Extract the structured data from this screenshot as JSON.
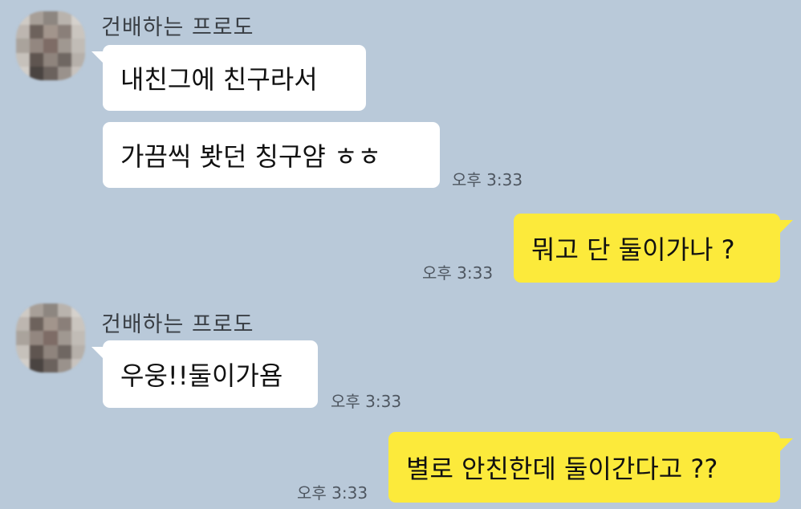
{
  "conversation": {
    "groups": [
      {
        "sender": "건배하는 프로도",
        "messages": [
          "내친그에 친구라서",
          "가끔씩 봣던 칭구얌 ㅎㅎ"
        ],
        "time": "오후 3:33"
      },
      {
        "me": true,
        "message": "뭐고 단 둘이가나 ?",
        "time": "오후 3:33"
      },
      {
        "sender": "건배하는 프로도",
        "messages": [
          "우웅!!둘이가욤"
        ],
        "time": "오후 3:33"
      },
      {
        "me": true,
        "message": "별로 안친한데 둘이간다고 ??",
        "time": "오후 3:33"
      }
    ]
  },
  "colors": {
    "background": "#b9c9d9",
    "incoming_bubble": "#ffffff",
    "outgoing_bubble": "#fcea3b",
    "time_text": "#4e5660"
  },
  "icons": {
    "avatar": "blurred-profile-photo"
  }
}
